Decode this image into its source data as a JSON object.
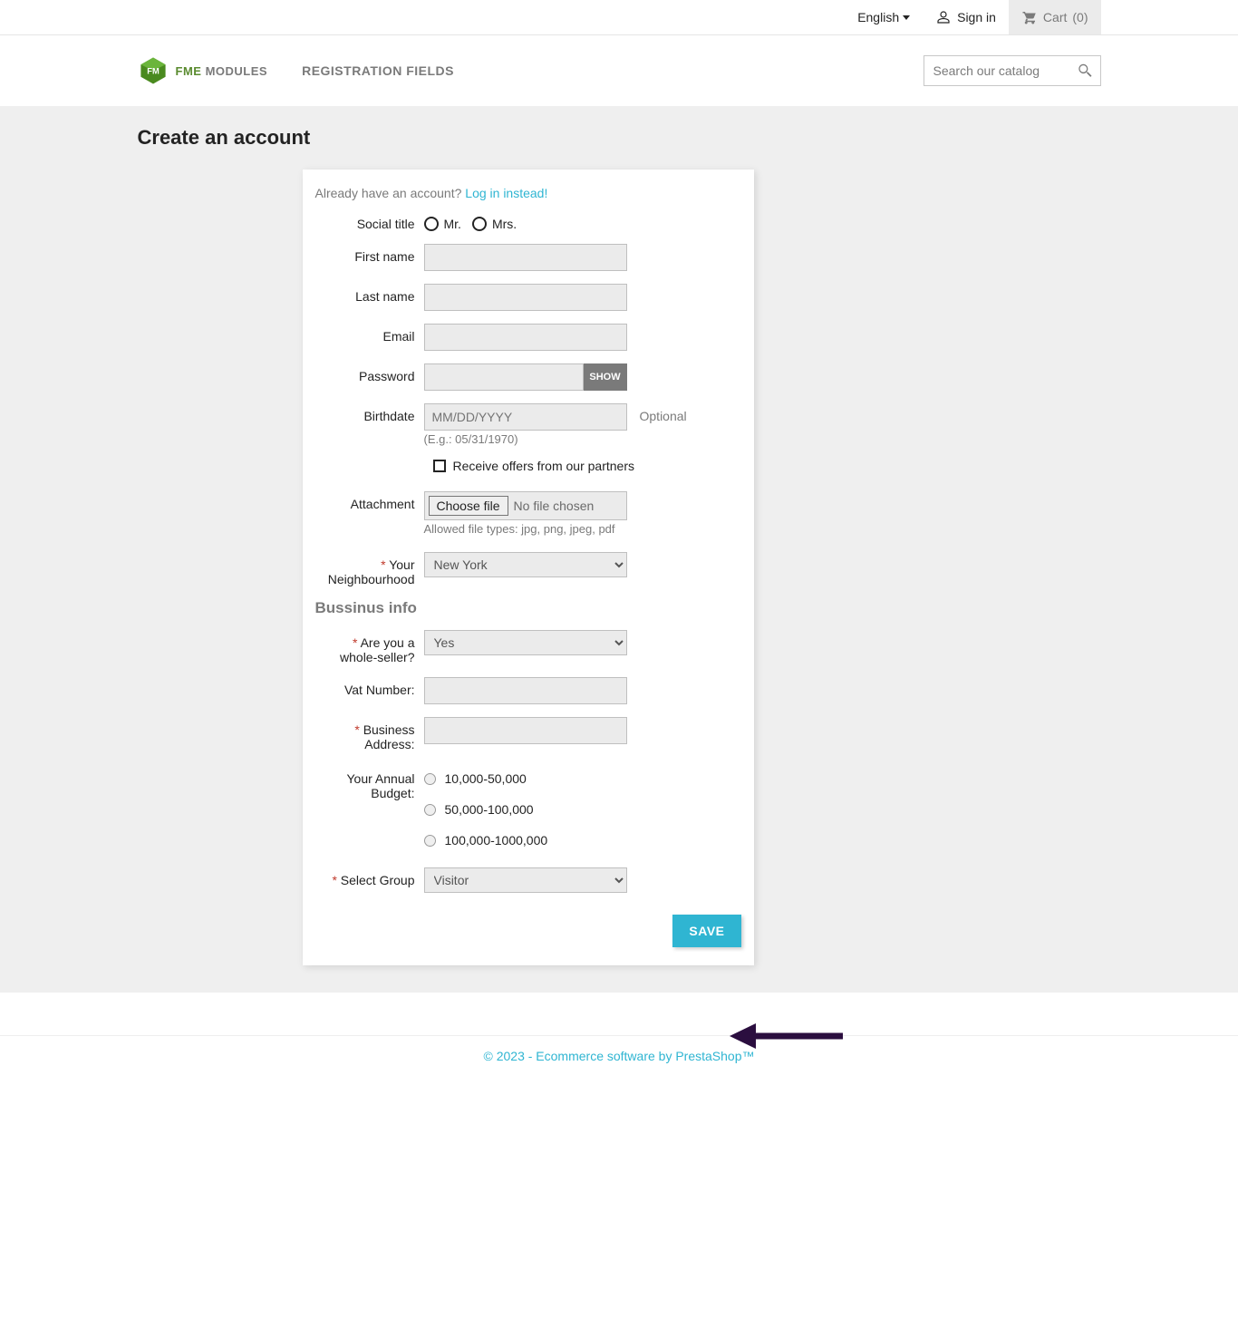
{
  "topbar": {
    "language": "English",
    "signin": "Sign in",
    "cart_label": "Cart",
    "cart_count": "(0)"
  },
  "header": {
    "logo_primary": "FME",
    "logo_secondary": "MODULES",
    "nav_registration": "REGISTRATION FIELDS",
    "search_placeholder": "Search our catalog"
  },
  "page": {
    "title": "Create an account",
    "already_text": "Already have an account? ",
    "login_link": "Log in instead!"
  },
  "form": {
    "social_title_label": "Social title",
    "mr_label": "Mr.",
    "mrs_label": "Mrs.",
    "first_name_label": "First name",
    "last_name_label": "Last name",
    "email_label": "Email",
    "password_label": "Password",
    "show_btn": "SHOW",
    "birthdate_label": "Birthdate",
    "birthdate_placeholder": "MM/DD/YYYY",
    "birthdate_optional": "Optional",
    "birthdate_hint": "(E.g.: 05/31/1970)",
    "partners_label": "Receive offers from our partners",
    "attachment_label": "Attachment",
    "choose_file": "Choose file",
    "no_file": "No file chosen",
    "file_hint": "Allowed file types: jpg, png, jpeg, pdf",
    "neighbourhood_label": "Your Neighbourhood",
    "neighbourhood_value": "New York",
    "section_business": "Bussinus info",
    "wholesaler_label": "Are you a whole-seller?",
    "wholesaler_value": "Yes",
    "vat_label": "Vat Number:",
    "biz_address_label": "Business Address:",
    "budget_label": "Your Annual Budget:",
    "budget_opt1": "10,000-50,000",
    "budget_opt2": "50,000-100,000",
    "budget_opt3": "100,000-1000,000",
    "select_group_label": "Select Group",
    "select_group_value": "Visitor",
    "save_btn": "SAVE"
  },
  "footer": {
    "text": "© 2023 - Ecommerce software by PrestaShop™"
  }
}
